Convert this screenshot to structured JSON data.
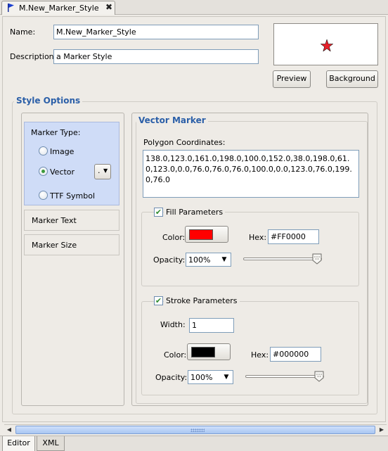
{
  "tab": {
    "title": "M.New_Marker_Style",
    "close": "✖"
  },
  "form": {
    "name_label": "Name:",
    "name_value": "M.New_Marker_Style",
    "description_label": "Description:",
    "description_value": "a Marker Style"
  },
  "buttons": {
    "preview": "Preview",
    "background": "Background"
  },
  "style_options": {
    "title": "Style Options",
    "marker_type_label": "Marker Type:",
    "options": [
      {
        "label": "Image",
        "selected": false
      },
      {
        "label": "Vector",
        "selected": true
      },
      {
        "label": "TTF Symbol",
        "selected": false
      }
    ],
    "vector_dropdown": ".",
    "side_items": [
      "Marker Text",
      "Marker Size"
    ]
  },
  "vector_marker": {
    "title": "Vector Marker",
    "polygon_label": "Polygon Coordinates:",
    "polygon_value": "138.0,123.0,161.0,198.0,100.0,152.0,38.0,198.0,61.0,123.0,0.0,76.0,76.0,76.0,100.0,0.0,123.0,76.0,199.0,76.0"
  },
  "fill": {
    "title": "Fill Parameters",
    "checked": true,
    "color_label": "Color:",
    "color": "#FF0000",
    "hex_label": "Hex:",
    "hex_value": "#FF0000",
    "opacity_label": "Opacity:",
    "opacity_value": "100%",
    "opacity_level": 1.0
  },
  "stroke": {
    "title": "Stroke Parameters",
    "checked": true,
    "width_label": "Width:",
    "width_value": "1",
    "color_label": "Color:",
    "color": "#000000",
    "hex_label": "Hex:",
    "hex_value": "#000000",
    "opacity_label": "Opacity:",
    "opacity_value": "100%",
    "opacity_level": 1.0
  },
  "preview_star_color": "#e8202a",
  "accent_color": "#2b5fa8",
  "bottom_tabs": [
    "Editor",
    "XML"
  ]
}
